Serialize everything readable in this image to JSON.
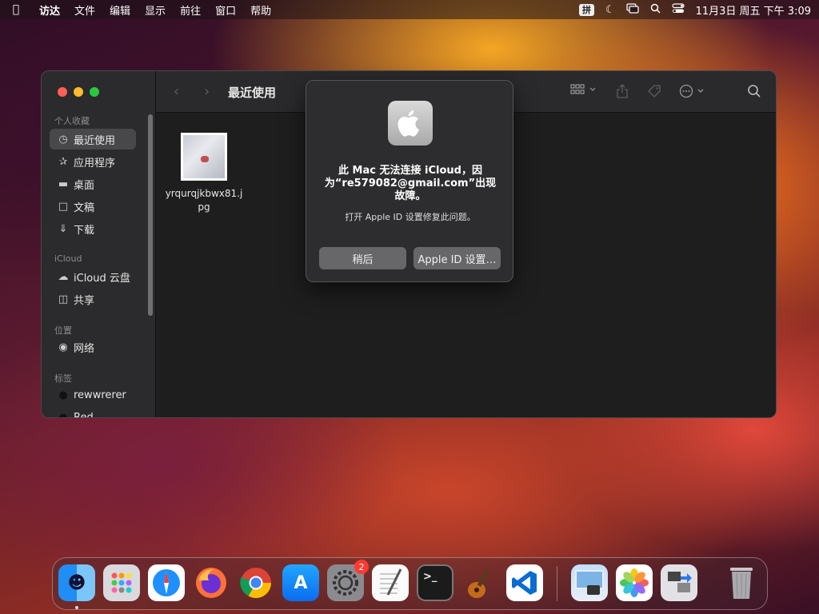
{
  "menubar": {
    "app_name": "访达",
    "items": [
      "文件",
      "编辑",
      "显示",
      "前往",
      "窗口",
      "帮助"
    ],
    "ime": "拼",
    "datetime": "11月3日 周五  下午 3:09"
  },
  "finder": {
    "title": "最近使用",
    "sidebar": {
      "favorites_header": "个人收藏",
      "favorites": [
        "最近使用",
        "应用程序",
        "桌面",
        "文稿",
        "下载"
      ],
      "icloud_header": "iCloud",
      "icloud": [
        "iCloud 云盘",
        "共享"
      ],
      "locations_header": "位置",
      "locations": [
        "网络"
      ],
      "tags_header": "标签",
      "tags": [
        "rewwrerer",
        "Red"
      ]
    },
    "file": {
      "name": "yrqurqjkbwx81.jpg"
    }
  },
  "alert": {
    "title": "此 Mac 无法连接 iCloud，因为“re579082@gmail.com”出现故障。",
    "message": "打开 Apple ID 设置修复此问题。",
    "later_button": "稍后",
    "settings_button": "Apple ID 设置…"
  },
  "dock": {
    "apps": [
      "finder",
      "launchpad",
      "safari",
      "firefox",
      "chrome",
      "app-store",
      "system-settings",
      "textedit",
      "terminal",
      "garageband",
      "vscode",
      "preview",
      "photos",
      "migration",
      "trash"
    ],
    "settings_badge": "2",
    "terminal_label": ">_"
  },
  "colors": {
    "close": "#ff5f57",
    "minimize": "#febc2e",
    "zoom": "#28c840",
    "badge": "#ff3b30"
  }
}
